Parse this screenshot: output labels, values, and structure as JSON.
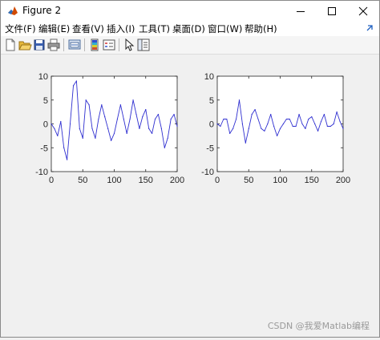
{
  "window": {
    "title": "Figure 2"
  },
  "menu": [
    {
      "label": "文件(F)"
    },
    {
      "label": "编辑(E)"
    },
    {
      "label": "查看(V)"
    },
    {
      "label": "插入(I)"
    },
    {
      "label": "工具(T)"
    },
    {
      "label": "桌面(D)"
    },
    {
      "label": "窗口(W)"
    },
    {
      "label": "帮助(H)"
    }
  ],
  "toolbar": [
    {
      "icon": "new-figure-icon"
    },
    {
      "icon": "open-file-icon"
    },
    {
      "icon": "save-icon"
    },
    {
      "icon": "print-icon"
    },
    {
      "icon": "link-plot-icon"
    },
    {
      "icon": "insert-colorbar-icon"
    },
    {
      "icon": "insert-legend-icon"
    },
    {
      "icon": "select-arrow-icon"
    },
    {
      "icon": "property-inspector-icon"
    }
  ],
  "watermark": "CSDN @我爱Matlab编程",
  "colors": {
    "line": "#2f2fd0",
    "axes_background": "#ffffff",
    "figure_background": "#f0f0f0"
  },
  "chart_data": [
    {
      "type": "line",
      "x": [
        0,
        5,
        10,
        15,
        20,
        25,
        30,
        35,
        40,
        45,
        50,
        55,
        60,
        65,
        70,
        75,
        80,
        85,
        90,
        95,
        100,
        105,
        110,
        115,
        120,
        125,
        130,
        135,
        140,
        145,
        150,
        155,
        160,
        165,
        170,
        175,
        180,
        185,
        190,
        195,
        200
      ],
      "series": [
        {
          "values": [
            0,
            -1,
            -2.5,
            0.5,
            -5,
            -7.5,
            0,
            8,
            9,
            -1,
            -3,
            5,
            4,
            -1,
            -3,
            1,
            4,
            1.5,
            -1,
            -3.5,
            -2,
            1,
            4,
            1,
            -2,
            1,
            5,
            2,
            -1,
            1.5,
            3,
            -1,
            -2,
            1,
            2,
            -1,
            -5,
            -3,
            1,
            2,
            -0.5
          ]
        }
      ],
      "xlim": [
        0,
        200
      ],
      "ylim": [
        -10,
        10
      ],
      "xticks": [
        0,
        50,
        100,
        150,
        200
      ],
      "yticks": [
        -10,
        -5,
        0,
        5,
        10
      ],
      "title": "",
      "xlabel": "",
      "ylabel": "",
      "grid": false
    },
    {
      "type": "line",
      "x": [
        0,
        5,
        10,
        15,
        20,
        25,
        30,
        35,
        40,
        45,
        50,
        55,
        60,
        65,
        70,
        75,
        80,
        85,
        90,
        95,
        100,
        105,
        110,
        115,
        120,
        125,
        130,
        135,
        140,
        145,
        150,
        155,
        160,
        165,
        170,
        175,
        180,
        185,
        190,
        195,
        200
      ],
      "series": [
        {
          "values": [
            0,
            -0.5,
            1,
            1,
            -2,
            -1,
            1,
            5,
            0,
            -4,
            -1,
            2,
            3,
            1,
            -1,
            -1.5,
            0,
            2,
            -0.5,
            -2.5,
            -1,
            0,
            1,
            1,
            -0.5,
            -0.5,
            2,
            0,
            -1,
            1,
            1.5,
            0,
            -1.5,
            0.5,
            2,
            -0.5,
            -0.5,
            0,
            2.5,
            0.5,
            -1
          ]
        }
      ],
      "xlim": [
        0,
        200
      ],
      "ylim": [
        -10,
        10
      ],
      "xticks": [
        0,
        50,
        100,
        150,
        200
      ],
      "yticks": [
        -10,
        -5,
        0,
        5,
        10
      ],
      "title": "",
      "xlabel": "",
      "ylabel": "",
      "grid": false
    }
  ]
}
